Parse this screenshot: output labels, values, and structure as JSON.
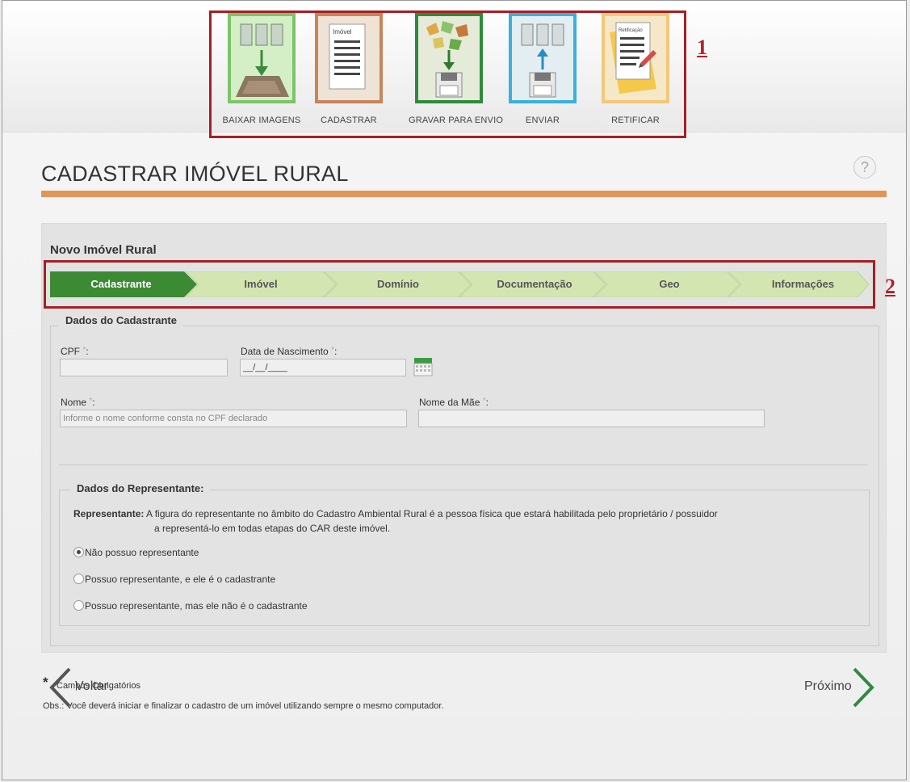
{
  "workflow": {
    "steps": [
      {
        "label": "BAIXAR IMAGENS",
        "color": "#7cc46a",
        "icon": "download-images-icon"
      },
      {
        "label": "CADASTRAR",
        "color": "#c8845a",
        "icon": "register-icon"
      },
      {
        "label": "GRAVAR PARA ENVIO",
        "color": "#2e8b3e",
        "icon": "save-icon"
      },
      {
        "label": "ENVIAR",
        "color": "#3ab0dc",
        "icon": "send-icon"
      },
      {
        "label": "RETIFICAR",
        "color": "#f2c879",
        "icon": "rectify-icon"
      }
    ],
    "register_doc_label": "Imóvel",
    "rectify_doc_label": "Retificação",
    "marker": "1"
  },
  "page": {
    "title": "CADASTRAR IMÓVEL RURAL",
    "help": "?"
  },
  "form": {
    "heading": "Novo Imóvel Rural",
    "marker": "2",
    "tabs": [
      {
        "label": "Cadastrante",
        "active": true
      },
      {
        "label": "Imóvel",
        "active": false
      },
      {
        "label": "Domínio",
        "active": false
      },
      {
        "label": "Documentação",
        "active": false
      },
      {
        "label": "Geo",
        "active": false
      },
      {
        "label": "Informações",
        "active": false
      }
    ],
    "cadastrante": {
      "legend": "Dados do Cadastrante",
      "cpf_label": "CPF",
      "birth_label": "Data de Nascimento",
      "birth_value": "__/__/____",
      "name_label": "Nome",
      "name_placeholder": "Informe o nome conforme consta no CPF declarado",
      "mother_label": "Nome da Mãe",
      "required_mark": "*",
      "colon": ":"
    },
    "representante": {
      "legend": "Dados do Representante:",
      "desc_bold": "Representante:",
      "desc_line1": "A figura do representante no âmbito do Cadastro Ambiental Rural é a pessoa física que estará habilitada pelo proprietário / possuidor",
      "desc_line2": "a representá-lo em todas etapas do CAR deste imóvel.",
      "options": [
        {
          "label": "Não possuo representante",
          "checked": true
        },
        {
          "label": "Possuo representante, e ele é o cadastrante",
          "checked": false
        },
        {
          "label": "Possuo representante, mas ele não é o cadastrante",
          "checked": false
        }
      ]
    }
  },
  "footer": {
    "asterisk": "*",
    "required_note": "Campos Obrigatórios",
    "obs": "Obs.: Você deverá iniciar e finalizar o cadastro de um imóvel utilizando sempre o mesmo computador.",
    "back": "Voltar",
    "next": "Próximo"
  },
  "colors": {
    "accent_orange": "#e29559",
    "tab_active": "#3d8a34",
    "tab_inactive": "#d3e6b2",
    "highlight_red": "#a51f23",
    "nav_green": "#2e8b3e"
  }
}
